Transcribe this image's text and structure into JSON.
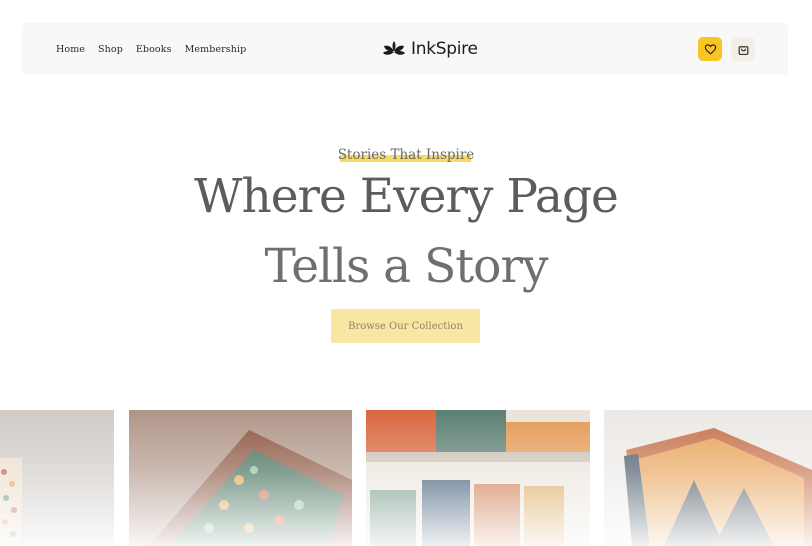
{
  "nav": {
    "links": [
      "Home",
      "Shop",
      "Ebooks",
      "Membership"
    ],
    "brand": "InkSpire",
    "actions": {
      "wishlist": "heart-icon",
      "cart": "bag-icon"
    }
  },
  "hero": {
    "eyebrow": "Stories That Inspire",
    "title_line1": "Where Every Page",
    "title_line2": "Tells a Story",
    "cta_label": "Browse Our Collection"
  },
  "colors": {
    "accent": "#f7c623",
    "highlight": "#f7d965",
    "cta_bg": "#f8e7a2",
    "nav_bg": "#f8f8f8"
  },
  "gallery": {
    "images": [
      "patterned-book-cover",
      "floral-notebook",
      "illustrated-books-shelf",
      "forest-sunset-book"
    ]
  }
}
